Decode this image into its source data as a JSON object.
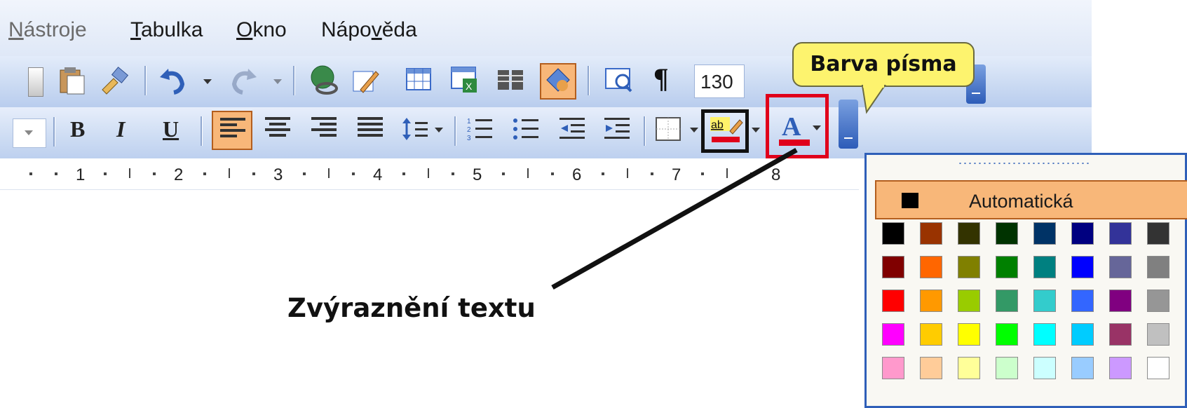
{
  "menu": {
    "items": [
      {
        "label": "Nástroje",
        "accesskey_index": 0
      },
      {
        "label": "Tabulka",
        "accesskey_index": 0
      },
      {
        "label": "Okno",
        "accesskey_index": 0
      },
      {
        "label": "Nápověda",
        "accesskey_index": 4
      }
    ]
  },
  "toolbar": {
    "zoom_value": "130",
    "pilcrow_glyph": "¶",
    "format": {
      "bold": "B",
      "italic": "I",
      "underline": "U"
    },
    "highlight_icon_text": "ab",
    "font_color_icon_text": "A"
  },
  "ruler": {
    "numbers": [
      "1",
      "2",
      "3",
      "4",
      "5",
      "6",
      "7",
      "8"
    ]
  },
  "callout": {
    "text": "Barva písma"
  },
  "annotation": {
    "text": "Zvýraznění textu"
  },
  "color_panel": {
    "automatic_label": "Automatická",
    "rows": [
      [
        "#000000",
        "#993300",
        "#333300",
        "#003300",
        "#003366",
        "#000080",
        "#333399",
        "#333333"
      ],
      [
        "#800000",
        "#ff6600",
        "#808000",
        "#008000",
        "#008080",
        "#0000ff",
        "#666699",
        "#808080"
      ],
      [
        "#ff0000",
        "#ff9900",
        "#99cc00",
        "#339966",
        "#33cccc",
        "#3366ff",
        "#800080",
        "#969696"
      ],
      [
        "#ff00ff",
        "#ffcc00",
        "#ffff00",
        "#00ff00",
        "#00ffff",
        "#00ccff",
        "#993366",
        "#c0c0c0"
      ],
      [
        "#ff99cc",
        "#ffcc99",
        "#ffff99",
        "#ccffcc",
        "#ccffff",
        "#99ccff",
        "#cc99ff",
        "#ffffff"
      ]
    ]
  },
  "colors": {
    "highlight_border": "#111111",
    "font_color_border": "#e0001b",
    "callout_fill": "#fdf36e",
    "active_button": "#f8b779"
  }
}
